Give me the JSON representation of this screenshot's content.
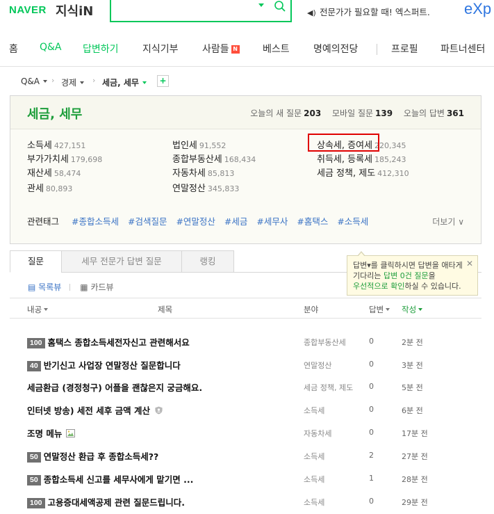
{
  "header": {
    "logo_brand": "NAVER",
    "logo_service": "지식iN",
    "search_value": "",
    "promo": "전문가가 필요할 때! 엑스퍼트.",
    "exp_logo": "eXp",
    "brand_color": "#03c75a"
  },
  "nav": {
    "items": [
      "홈",
      "Q&A",
      "답변하기",
      "지식기부",
      "사람들",
      "베스트",
      "명예의전당",
      "프로필",
      "파트너센터"
    ],
    "people_badge": "N",
    "active": "Q&A"
  },
  "breadcrumb": {
    "items": [
      "Q&A",
      "경제",
      "세금, 세무"
    ],
    "plus": "+"
  },
  "category": {
    "title": "세금, 세무",
    "stats": [
      {
        "label": "오늘의 새 질문",
        "value": "203"
      },
      {
        "label": "모바일 질문",
        "value": "139"
      },
      {
        "label": "오늘의 답변",
        "value": "361"
      }
    ],
    "subcategories": [
      {
        "name": "소득세",
        "count": "427,151"
      },
      {
        "name": "부가가치세",
        "count": "179,698"
      },
      {
        "name": "재산세",
        "count": "58,474"
      },
      {
        "name": "관세",
        "count": "80,893"
      },
      {
        "name": "법인세",
        "count": "91,552"
      },
      {
        "name": "종합부동산세",
        "count": "168,434"
      },
      {
        "name": "자동차세",
        "count": "85,813"
      },
      {
        "name": "연말정산",
        "count": "345,833"
      },
      {
        "name": "상속세, 증여세",
        "count": "220,345"
      },
      {
        "name": "취득세, 등록세",
        "count": "185,243"
      },
      {
        "name": "세금 정책, 제도",
        "count": "412,310"
      }
    ],
    "tags_label": "관련태그",
    "tags": [
      "#종합소득세",
      "#검색질문",
      "#연말정산",
      "#세금",
      "#세무사",
      "#홈택스",
      "#소득세"
    ],
    "more": "더보기"
  },
  "tabs": [
    "질문",
    "세무 전문가 답변 질문",
    "랭킹"
  ],
  "tooltip": {
    "line1": "답변▾를 클릭하시면 답변을 애타게",
    "line2a": "기다리는 ",
    "line2b": "답변 0건 질문",
    "line2c": "을",
    "line3a": "우선적으로 확인",
    "line3b": "하실 수 있습니다.",
    "close": "✕"
  },
  "view": {
    "list": "목록뷰",
    "card": "카드뷰"
  },
  "table": {
    "headers": {
      "bounty": "내공",
      "title": "제목",
      "field": "분야",
      "answers": "답변",
      "written": "작성"
    },
    "rows": [
      {
        "bounty": "100",
        "title": "홈택스 종합소득세전자신고 관련해서요",
        "field": "종합부동산세",
        "answers": "0",
        "time": "2분 전"
      },
      {
        "bounty": "40",
        "title": "반기신고 사업장 연말정산 질문합니다",
        "field": "연말정산",
        "answers": "0",
        "time": "3분 전"
      },
      {
        "bounty": "",
        "title": "세금환급 (경정청구) 어플을 괜찮은지 궁금해요.",
        "field": "세금 정책, 제도",
        "answers": "0",
        "time": "5분 전"
      },
      {
        "bounty": "",
        "title": "인터넷 방송) 세전 세후 금액 계산",
        "field": "소득세",
        "answers": "0",
        "time": "6분 전",
        "icon": "shield-icon"
      },
      {
        "bounty": "",
        "title": "조명 메뉴",
        "field": "자동차세",
        "answers": "0",
        "time": "17분 전",
        "icon": "image-icon"
      },
      {
        "bounty": "50",
        "title": "연말정산 환급 후 종합소득세??",
        "field": "소득세",
        "answers": "2",
        "time": "27분 전"
      },
      {
        "bounty": "50",
        "title": "종합소득세 신고를 세무사에게 맡기면 ...",
        "field": "소득세",
        "answers": "1",
        "time": "28분 전"
      },
      {
        "bounty": "100",
        "title": "고용증대세액공제 관련 질문드립니다.",
        "field": "소득세",
        "answers": "0",
        "time": "29분 전"
      }
    ]
  }
}
